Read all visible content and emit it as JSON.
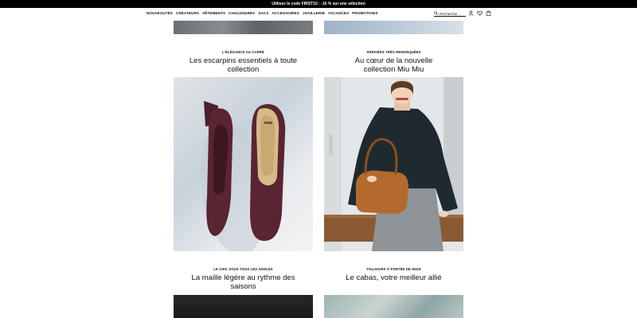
{
  "promo": {
    "text": "Utilisez le code FIRST10 : -10 % sur une sélection"
  },
  "nav": {
    "links": [
      "NOUVEAUTÉS",
      "CRÉATEURS",
      "VÊTEMENTS",
      "CHAUSSURES",
      "SACS",
      "ACCESSOIRES",
      "JOAILLERIE",
      "VACANCES",
      "PROMOTIONS"
    ],
    "search_placeholder": "Recherche..."
  },
  "icons": {
    "search": "search-icon",
    "account": "user-icon",
    "wishlist": "heart-icon",
    "bag": "shopping-bag-icon"
  },
  "cards": [
    {
      "kicker": "L'ÉLÉGANCE AU CARRÉ",
      "title": "Les escarpins essentiels à toute collection"
    },
    {
      "kicker": "ARRIVÉES TRÈS REMARQUÉES",
      "title": "Au cœur de la nouvelle collection Miu Miu"
    },
    {
      "kicker": "LE CHIC SOUS TOUS LES ANGLES",
      "title": "La maille légère au rythme des saisons"
    },
    {
      "kicker": "TOUJOURS À PORTÉE DE MAIN",
      "title": "Le cabas, votre meilleur allié"
    }
  ]
}
